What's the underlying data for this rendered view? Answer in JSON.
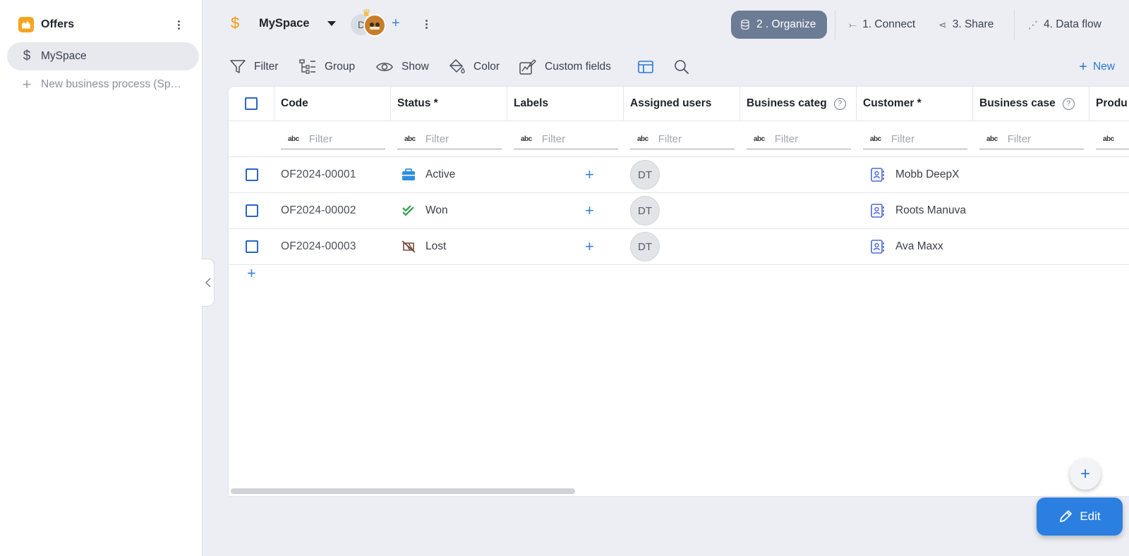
{
  "sidebar": {
    "app_title": "Offers",
    "items": [
      {
        "label": "MySpace",
        "icon": "dollar-icon"
      },
      {
        "label": "New business process (Space)",
        "icon": "plus-icon"
      }
    ]
  },
  "topbar": {
    "space_name": "MySpace",
    "avatar_letter": "D",
    "steps": {
      "organize": "2 . Organize",
      "connect": "1. Connect",
      "share": "3. Share",
      "dataflow": "4. Data flow"
    }
  },
  "toolbar": {
    "filter": "Filter",
    "group": "Group",
    "show": "Show",
    "color": "Color",
    "custom_fields": "Custom fields",
    "new": "New"
  },
  "table": {
    "columns": [
      "Code",
      "Status *",
      "Labels",
      "Assigned users",
      "Business categ",
      "Customer *",
      "Business case",
      "Produ"
    ],
    "filter_placeholder": "Filter",
    "abc_glyph": "abc",
    "rows": [
      {
        "code": "OF2024-00001",
        "status": "Active",
        "status_icon": "briefcase-icon",
        "assigned": "DT",
        "customer": "Mobb DeepX"
      },
      {
        "code": "OF2024-00002",
        "status": "Won",
        "status_icon": "double-check-icon",
        "assigned": "DT",
        "customer": "Roots Manuva"
      },
      {
        "code": "OF2024-00003",
        "status": "Lost",
        "status_icon": "lost-flag-icon",
        "assigned": "DT",
        "customer": "Ava Maxx"
      }
    ]
  },
  "actions": {
    "edit": "Edit"
  },
  "colors": {
    "accent": "#2a7fe0",
    "organize_bg": "#6d7c95",
    "logo": "#f6a41f",
    "dollar": "#f39a17"
  }
}
